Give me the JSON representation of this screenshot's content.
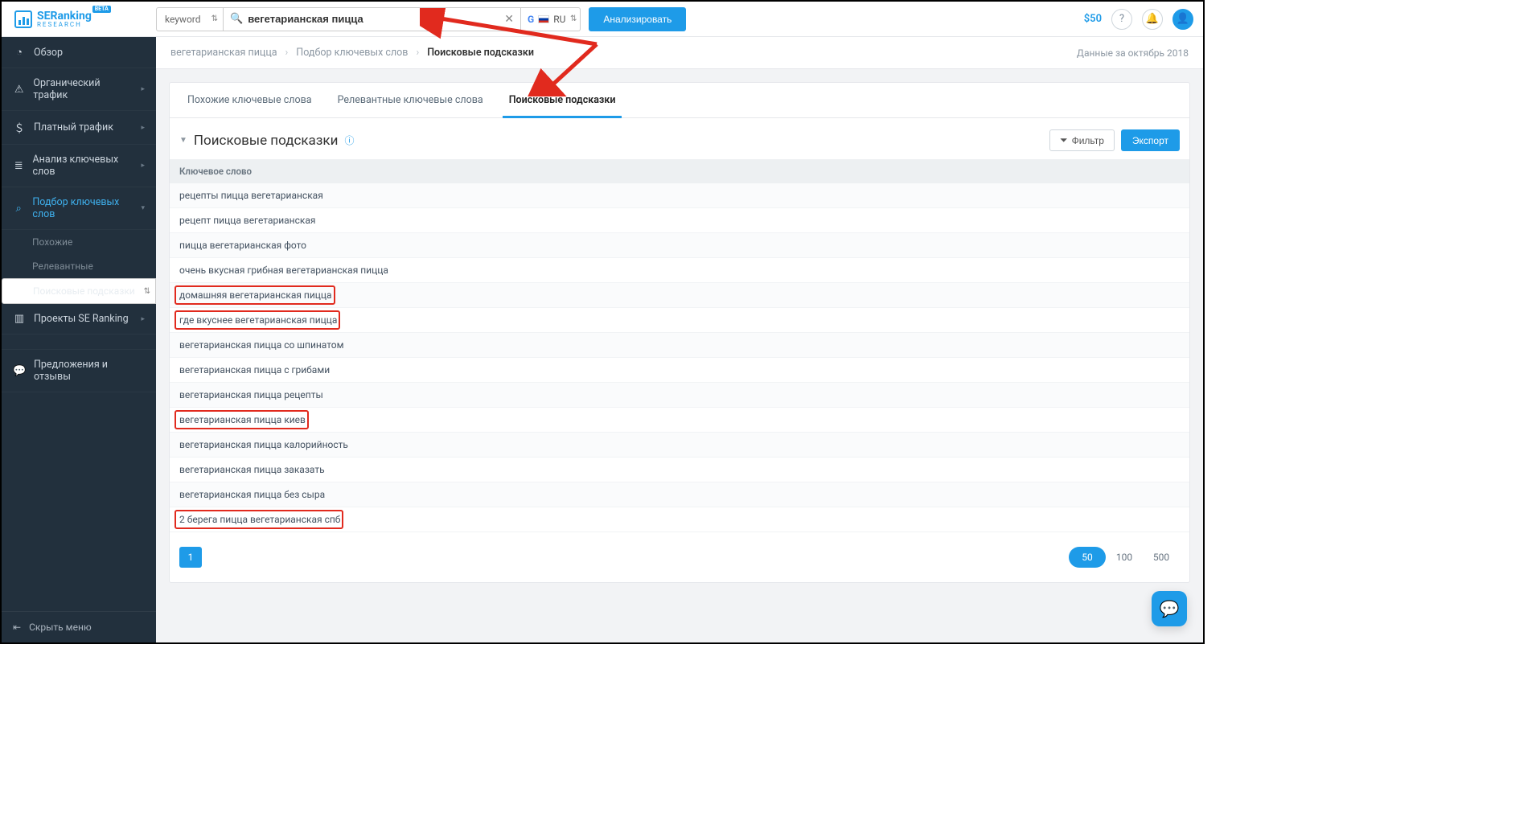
{
  "brand": {
    "name": "SERanking",
    "sub": "RESEARCH",
    "beta": "BETA"
  },
  "search": {
    "type_label": "keyword",
    "value": "вегетарианская пицца",
    "locale_code": "RU",
    "analyze": "Анализировать"
  },
  "topright": {
    "balance": "$50"
  },
  "sidebar": {
    "items": [
      {
        "icon": "◔",
        "label": "Обзор",
        "expandable": false
      },
      {
        "icon": "⚠",
        "label": "Органический трафик",
        "expandable": true
      },
      {
        "icon": "＄",
        "label": "Платный трафик",
        "expandable": true
      },
      {
        "icon": "≣",
        "label": "Анализ ключевых слов",
        "expandable": true
      },
      {
        "icon": "⌕",
        "label": "Подбор ключевых слов",
        "expandable": true,
        "active": true
      },
      {
        "icon": "▥",
        "label": "Проекты SE Ranking",
        "expandable": true
      }
    ],
    "subs": [
      {
        "label": "Похожие"
      },
      {
        "label": "Релевантные"
      },
      {
        "label": "Поисковые подсказки",
        "selected": true
      }
    ],
    "feedback": {
      "icon": "✎",
      "label": "Предложения и отзывы"
    },
    "collapse": "Скрыть меню"
  },
  "breadcrumb": {
    "a": "вегетарианская пицца",
    "b": "Подбор ключевых слов",
    "c": "Поисковые подсказки",
    "right": "Данные за октябрь 2018"
  },
  "tabs": [
    {
      "label": "Похожие ключевые слова"
    },
    {
      "label": "Релевантные ключевые слова"
    },
    {
      "label": "Поисковые подсказки",
      "active": true
    }
  ],
  "section": {
    "title": "Поисковые подсказки",
    "filter": "Фильтр",
    "export": "Экспорт",
    "col": "Ключевое слово"
  },
  "rows": [
    {
      "kw": "рецепты пицца вегетарианская"
    },
    {
      "kw": "рецепт пицца вегетарианская"
    },
    {
      "kw": "пицца вегетарианская фото"
    },
    {
      "kw": "очень вкусная грибная вегетарианская пицца"
    },
    {
      "kw": "домашняя вегетарианская пицца",
      "hl": true
    },
    {
      "kw": "где вкуснее вегетарианская пицца",
      "hl": true
    },
    {
      "kw": "вегетарианская пицца со шпинатом"
    },
    {
      "kw": "вегетарианская пицца с грибами"
    },
    {
      "kw": "вегетарианская пицца рецепты"
    },
    {
      "kw": "вегетарианская пицца киев",
      "hl": true
    },
    {
      "kw": "вегетарианская пицца калорийность"
    },
    {
      "kw": "вегетарианская пицца заказать"
    },
    {
      "kw": "вегетарианская пицца без сыра"
    },
    {
      "kw": "2 берега пицца вегетарианская спб",
      "hl": true
    }
  ],
  "pager": {
    "current": "1",
    "sizes": [
      "50",
      "100",
      "500"
    ],
    "size_sel": "50"
  }
}
